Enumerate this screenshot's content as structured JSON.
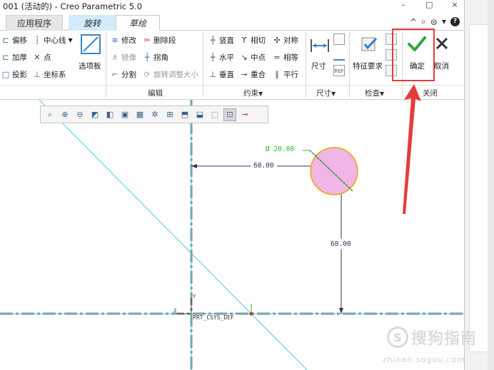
{
  "title": "001 (活动的) - Creo Parametric 5.0",
  "window_controls": [
    "–",
    "□",
    "×"
  ],
  "tabs": {
    "apps": "应用程序",
    "rotate": "旋转",
    "sketch": "草绘"
  },
  "tab_tools": [
    "^",
    "⌕",
    "?"
  ],
  "ribbon": {
    "col1": {
      "offset": "偏移",
      "thicken": "加厚",
      "project": "投影",
      "centerline": "中心线",
      "point": "点",
      "coord_sys": "坐标系",
      "palette": "选项板"
    },
    "edit": {
      "modify": "修改",
      "delete_segment": "删除段",
      "mirror": "镜像",
      "corner": "拐角",
      "divide": "分割",
      "rotate_resize": "旋转调整大小",
      "label": "编辑"
    },
    "constrain": {
      "vertical": "竖直",
      "tangent": "相切",
      "symmetric": "对称",
      "horizontal": "水平",
      "midpoint": "中点",
      "equal": "相等",
      "perpendicular": "垂直",
      "coincident": "重合",
      "parallel": "平行",
      "label": "约束"
    },
    "dimension": {
      "dim": "尺寸",
      "label": "尺寸"
    },
    "inspect": {
      "feature_req": "特征要求",
      "label": "检查"
    },
    "close": {
      "ok": "确定",
      "cancel": "取消",
      "label": "关闭"
    }
  },
  "sketch": {
    "diameter_label": "Ø 20.00",
    "horizontal_dim": "60.00",
    "vertical_dim": "60.00",
    "csys_label": "PRT_CSYS_DEF",
    "axis_x": "Z",
    "axis_y": "Y"
  },
  "watermark": {
    "brand": "搜狗指南",
    "url": "zhinan.sogou.com"
  },
  "colors": {
    "circle_fill": "#efb6e6",
    "circle_stroke": "#f0a500",
    "dimension": "#3a2a6a",
    "diameter": "#22bb22",
    "centerline": "#4ccfe0",
    "highlight": "#e53b3b"
  }
}
